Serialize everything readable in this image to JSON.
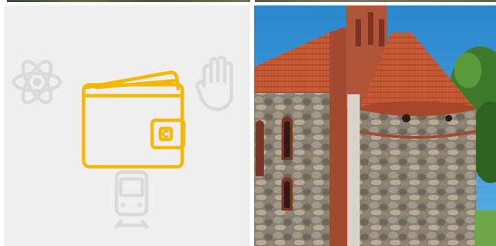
{
  "grid": {
    "tiles": [
      {
        "kind": "icon-collage",
        "background": "#efefef",
        "accent_color": "#f5b700",
        "faint_icon_color": "#dadada",
        "icons": [
          "atom-icon",
          "hand-icon",
          "wallet-icon",
          "train-icon"
        ],
        "highlighted_icon": "wallet-icon"
      },
      {
        "kind": "photo",
        "subject": "brick-and-fieldstone-church-with-round-apse",
        "colors": {
          "sky": "#2f8fd0",
          "roof": "#c65a36",
          "brick": "#a24a2f",
          "stone": "#8f8678",
          "foliage": "#3f7a2a"
        }
      }
    ]
  }
}
